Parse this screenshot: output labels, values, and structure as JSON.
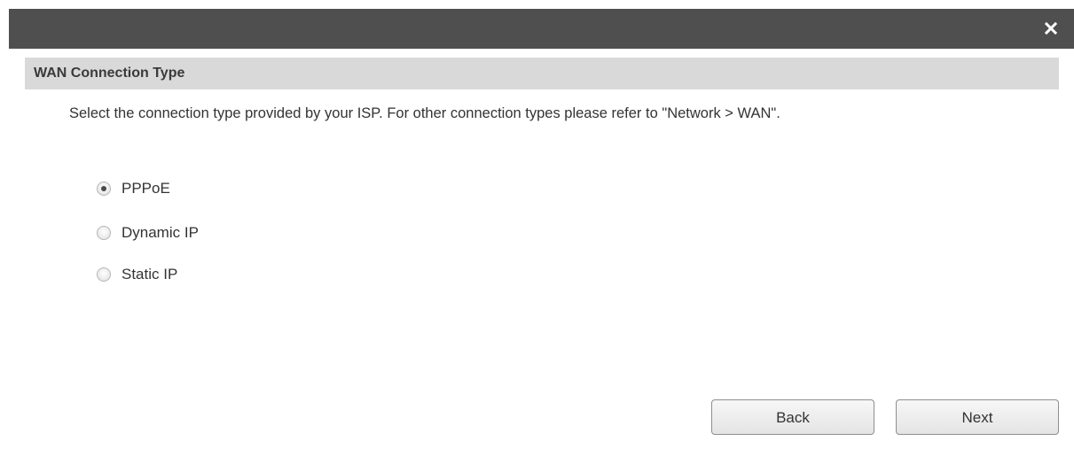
{
  "dialog": {
    "close_icon": "close-icon"
  },
  "section": {
    "title": "WAN Connection Type"
  },
  "description": "Select the connection type provided by your ISP. For other connection types please refer to \"Network > WAN\".",
  "options": [
    {
      "label": "PPPoE",
      "selected": true
    },
    {
      "label": "Dynamic IP",
      "selected": false
    },
    {
      "label": "Static IP",
      "selected": false
    }
  ],
  "buttons": {
    "back_label": "Back",
    "next_label": "Next"
  }
}
